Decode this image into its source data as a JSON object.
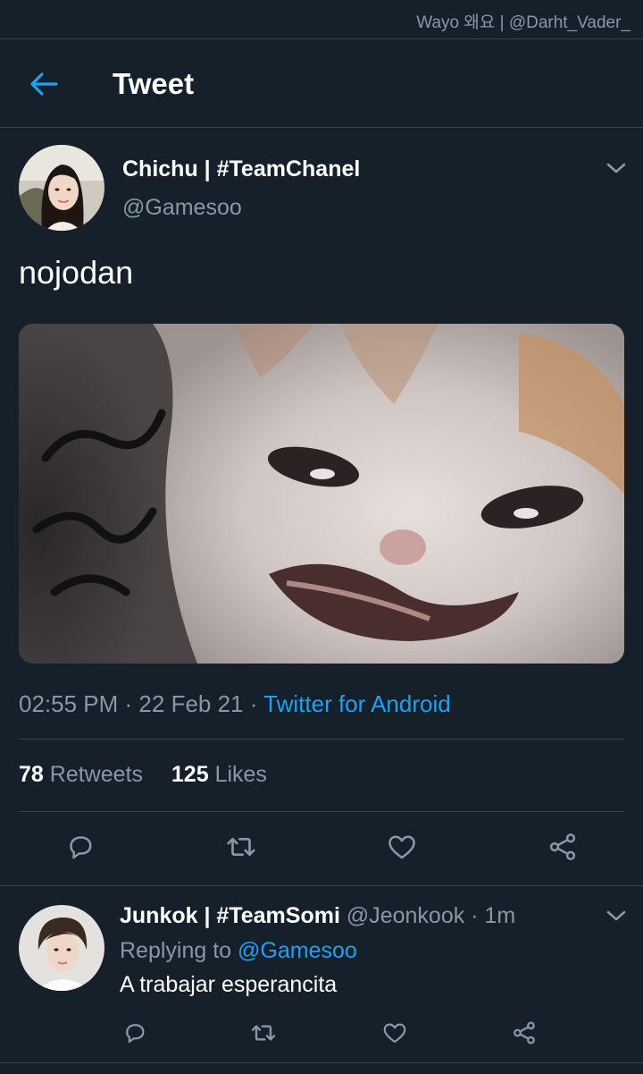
{
  "watermark": "Wayo 왜요 | @Darht_Vader_",
  "header": {
    "title": "Tweet"
  },
  "tweet": {
    "author_name": "Chichu | #TeamChanel",
    "author_handle": "@Gamesoo",
    "text": "nojodan",
    "time": "02:55 PM",
    "date": "22 Feb 21",
    "source": "Twitter for Android",
    "retweets_count": "78",
    "retweets_label": "Retweets",
    "likes_count": "125",
    "likes_label": "Likes"
  },
  "reply": {
    "author_name": "Junkok | #TeamSomi",
    "author_handle": "@Jeonkook",
    "time_ago": "1m",
    "replying_to_label": "Replying to",
    "replying_to_handle": "@Gamesoo",
    "text": "A trabajar esperancita"
  },
  "icons": [
    "back-arrow-icon",
    "chevron-down-icon",
    "reply-icon",
    "retweet-icon",
    "like-icon",
    "share-icon"
  ],
  "colors": {
    "background": "#15202b",
    "accent": "#1da1f2",
    "secondary_text": "#8899a6",
    "divider": "#38444d"
  }
}
